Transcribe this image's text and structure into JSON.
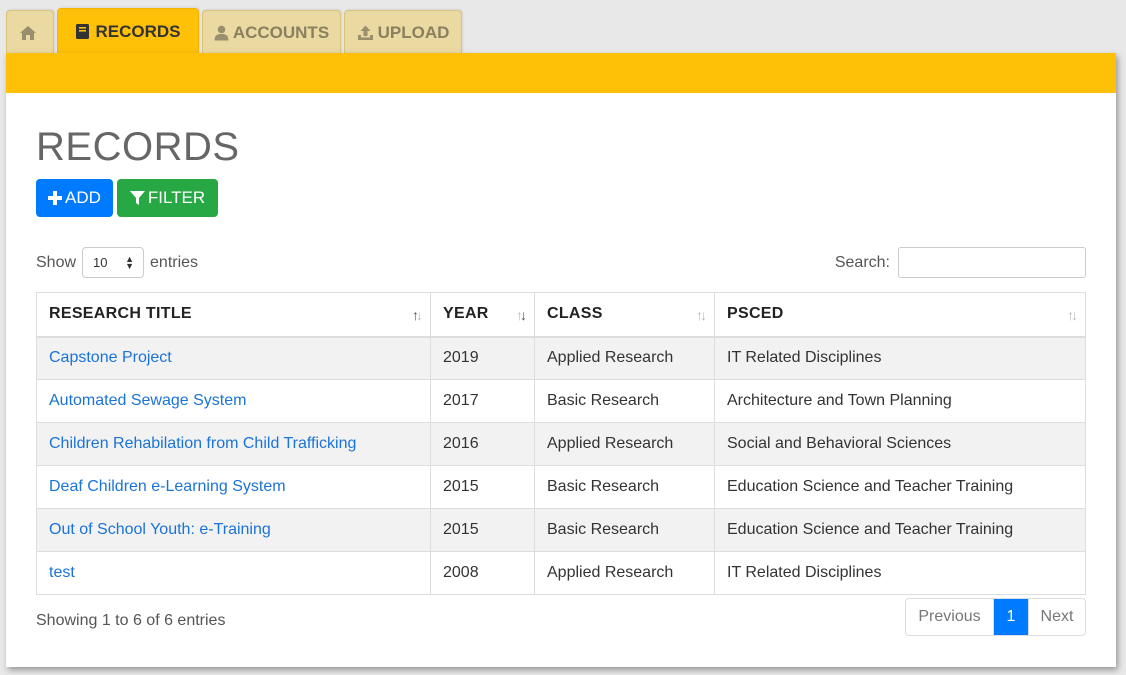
{
  "tabs": {
    "home_icon": "home-icon",
    "records": "RECORDS",
    "accounts": "ACCOUNTS",
    "upload": "UPLOAD"
  },
  "page": {
    "title": "RECORDS",
    "add_label": "ADD",
    "filter_label": "FILTER"
  },
  "controls": {
    "show_label": "Show",
    "entries_value": "10",
    "entries_label": "entries",
    "search_label": "Search:",
    "search_value": ""
  },
  "table": {
    "headers": [
      "RESEARCH TITLE",
      "YEAR",
      "CLASS",
      "PSCED"
    ],
    "rows": [
      {
        "title": "Capstone Project",
        "year": "2019",
        "class": "Applied Research",
        "psced": "IT Related Disciplines"
      },
      {
        "title": "Automated Sewage System",
        "year": "2017",
        "class": "Basic Research",
        "psced": "Architecture and Town Planning"
      },
      {
        "title": "Children Rehabilation from Child Trafficking",
        "year": "2016",
        "class": "Applied Research",
        "psced": "Social and Behavioral Sciences"
      },
      {
        "title": "Deaf Children e-Learning System",
        "year": "2015",
        "class": "Basic Research",
        "psced": "Education Science and Teacher Training"
      },
      {
        "title": "Out of School Youth: e-Training",
        "year": "2015",
        "class": "Basic Research",
        "psced": "Education Science and Teacher Training"
      },
      {
        "title": "test",
        "year": "2008",
        "class": "Applied Research",
        "psced": "IT Related Disciplines"
      }
    ]
  },
  "footer": {
    "info": "Showing 1 to 6 of 6 entries",
    "previous": "Previous",
    "current_page": "1",
    "next": "Next"
  },
  "colors": {
    "accent": "#ffc107",
    "tab_inactive": "#ead9a1",
    "primary": "#007bff",
    "success": "#28a745",
    "link": "#1a73d9"
  }
}
